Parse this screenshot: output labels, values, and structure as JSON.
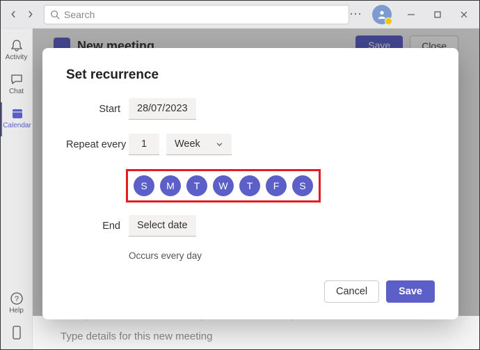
{
  "titlebar": {
    "search_placeholder": "Search"
  },
  "rail": {
    "items": [
      {
        "label": "Activity"
      },
      {
        "label": "Chat"
      },
      {
        "label": "Calendar"
      },
      {
        "label": "Help"
      }
    ]
  },
  "page": {
    "title": "New meeting",
    "save": "Save",
    "close": "Close"
  },
  "toolbar": {
    "paragraph": "Paragraph"
  },
  "editor": {
    "placeholder": "Type details for this new meeting"
  },
  "modal": {
    "title": "Set recurrence",
    "start_label": "Start",
    "start_value": "28/07/2023",
    "repeat_label": "Repeat every",
    "repeat_value": "1",
    "repeat_unit": "Week",
    "days": [
      "S",
      "M",
      "T",
      "W",
      "T",
      "F",
      "S"
    ],
    "end_label": "End",
    "end_value": "Select date",
    "occurs": "Occurs every day",
    "cancel": "Cancel",
    "save": "Save"
  }
}
